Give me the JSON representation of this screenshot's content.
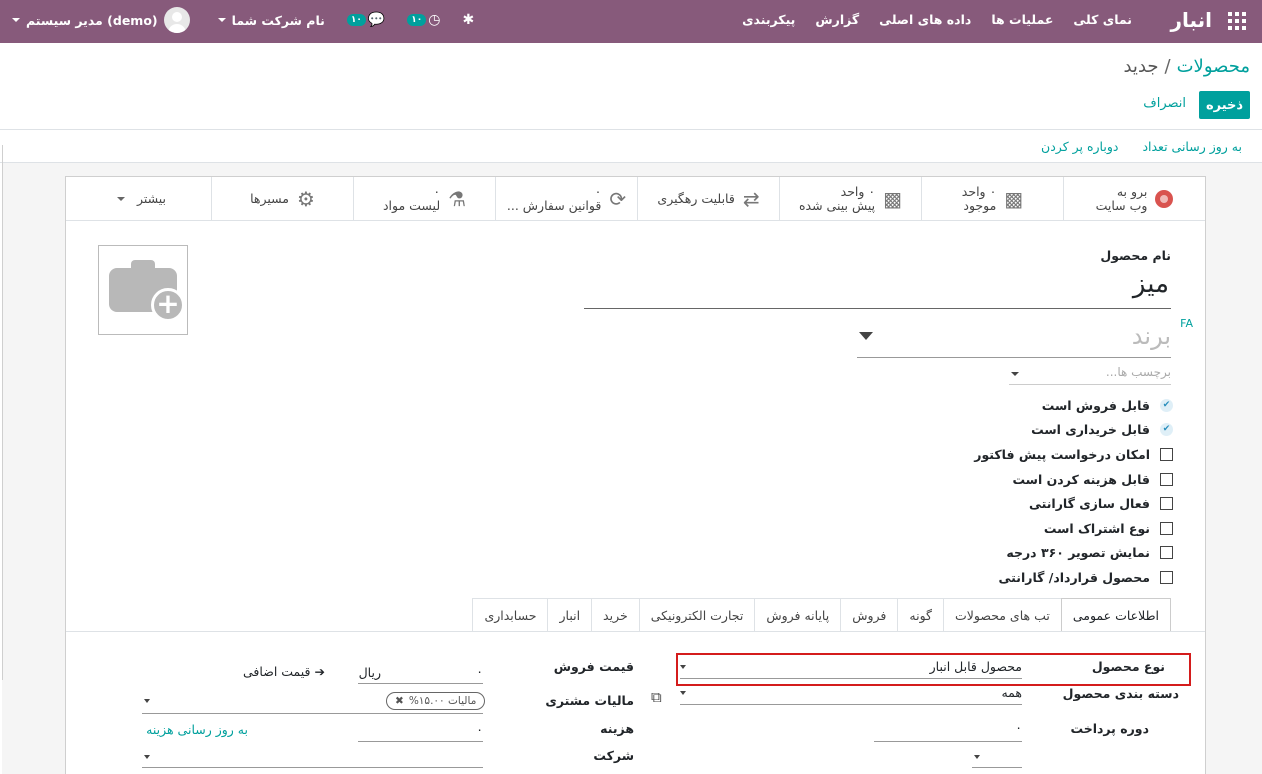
{
  "navbar": {
    "brand": "انبار",
    "menu": [
      "نمای کلی",
      "عملیات ها",
      "داده های اصلی",
      "گزارش",
      "پیکربندی"
    ],
    "user": "مدیر سیستم (demo)",
    "company": "نام شرکت شما",
    "badge_messages": "۱۰",
    "badge_activities": "۱۰",
    "icons": {
      "apps": "grid-icon",
      "messages": "chat-icon",
      "activities": "clock-icon",
      "debug": "bug-icon"
    },
    "color": "#875a7b"
  },
  "breadcrumb": {
    "parent": "محصولات",
    "separator": "/",
    "current": "جدید"
  },
  "actions": {
    "save": "ذخیره",
    "discard": "انصراف",
    "accent": "#00a09d"
  },
  "statusbar": {
    "update_qty": "به روز رسانی تعداد",
    "replenish": "دوباره پر کردن"
  },
  "buttonbox": {
    "website": {
      "line1": "برو به",
      "line2": "وب سایت"
    },
    "on_hand": {
      "line1": "۰ واحد",
      "line2": "موجود"
    },
    "forecasted": {
      "line1": "۰ واحد",
      "line2": "پیش بینی شده"
    },
    "traceability": "قابلیت رهگیری",
    "reorder": {
      "line1": "۰",
      "line2": "قوانین سفارش ..."
    },
    "bom": {
      "line1": "۰",
      "line2": "لیست مواد"
    },
    "routes": "مسیرها",
    "more": "بیشتر"
  },
  "form": {
    "name_label": "نام محصول",
    "name_value": "میز",
    "lang": "FA",
    "brand_placeholder": "برند",
    "tags_placeholder": "برچسب ها...",
    "checkboxes": [
      {
        "label": "قابل فروش است",
        "checked": true
      },
      {
        "label": "قابل خریداری است",
        "checked": true
      },
      {
        "label": "امکان درخواست پیش فاکتور",
        "checked": false
      },
      {
        "label": "قابل هزینه کردن است",
        "checked": false
      },
      {
        "label": "فعال سازی گارانتی",
        "checked": false
      },
      {
        "label": "نوع اشتراک است",
        "checked": false
      },
      {
        "label": "نمایش تصویر ۳۶۰ درجه",
        "checked": false
      },
      {
        "label": "محصول قرارداد/ گارانتی",
        "checked": false
      }
    ],
    "tabs": [
      "اطلاعات عمومی",
      "تب های محصولات",
      "گونه",
      "فروش",
      "پایانه فروش",
      "تجارت الکترونیکی",
      "خرید",
      "انبار",
      "حسابداری"
    ],
    "fields": {
      "product_type_label": "نوع محصول",
      "product_type_value": "محصول قابل انبار",
      "category_label": "دسته بندی محصول",
      "category_value": "همه",
      "payment_term_label": "دوره پرداخت",
      "payment_term_value": "۰",
      "sale_price_label": "قیمت فروش",
      "sale_price_value": "۰",
      "currency": "ریال",
      "extra_price": "قیمت اضافی",
      "customer_tax_label": "مالیات مشتری",
      "customer_tax_value": "مالیات ۱۵.۰۰%",
      "cost_label": "هزینه",
      "cost_value": "۰",
      "update_cost": "به روز رسانی هزینه",
      "company_label": "شرکت"
    }
  }
}
